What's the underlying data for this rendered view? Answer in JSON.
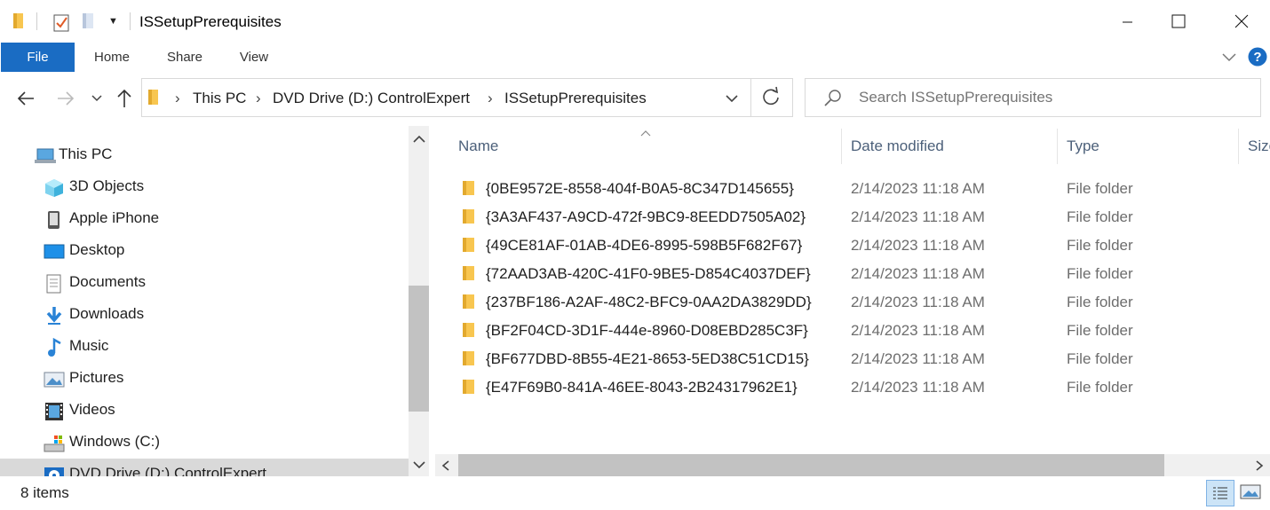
{
  "window": {
    "title": "ISSetupPrerequisites"
  },
  "ribbon": {
    "tabs": [
      "File",
      "Home",
      "Share",
      "View"
    ]
  },
  "address": {
    "crumbs": [
      "This PC",
      "DVD Drive (D:) ControlExpert",
      "ISSetupPrerequisites"
    ],
    "search_placeholder": "Search ISSetupPrerequisites"
  },
  "nav": {
    "items": [
      {
        "label": "This PC",
        "icon": "this-pc-icon"
      },
      {
        "label": "3D Objects",
        "icon": "3d-objects-icon"
      },
      {
        "label": "Apple iPhone",
        "icon": "phone-icon"
      },
      {
        "label": "Desktop",
        "icon": "desktop-icon"
      },
      {
        "label": "Documents",
        "icon": "documents-icon"
      },
      {
        "label": "Downloads",
        "icon": "downloads-icon"
      },
      {
        "label": "Music",
        "icon": "music-icon"
      },
      {
        "label": "Pictures",
        "icon": "pictures-icon"
      },
      {
        "label": "Videos",
        "icon": "videos-icon"
      },
      {
        "label": "Windows (C:)",
        "icon": "drive-icon"
      },
      {
        "label": "DVD Drive (D:) ControlExpert",
        "icon": "dvd-drive-icon"
      }
    ]
  },
  "columns": {
    "name": "Name",
    "date": "Date modified",
    "type": "Type",
    "size": "Size"
  },
  "files": [
    {
      "name": "{0BE9572E-8558-404f-B0A5-8C347D145655}",
      "date": "2/14/2023 11:18 AM",
      "type": "File folder"
    },
    {
      "name": "{3A3AF437-A9CD-472f-9BC9-8EEDD7505A02}",
      "date": "2/14/2023 11:18 AM",
      "type": "File folder"
    },
    {
      "name": "{49CE81AF-01AB-4DE6-8995-598B5F682F67}",
      "date": "2/14/2023 11:18 AM",
      "type": "File folder"
    },
    {
      "name": "{72AAD3AB-420C-41F0-9BE5-D854C4037DEF}",
      "date": "2/14/2023 11:18 AM",
      "type": "File folder"
    },
    {
      "name": "{237BF186-A2AF-48C2-BFC9-0AA2DA3829DD}",
      "date": "2/14/2023 11:18 AM",
      "type": "File folder"
    },
    {
      "name": "{BF2F04CD-3D1F-444e-8960-D08EBD285C3F}",
      "date": "2/14/2023 11:18 AM",
      "type": "File folder"
    },
    {
      "name": "{BF677DBD-8B55-4E21-8653-5ED38C51CD15}",
      "date": "2/14/2023 11:18 AM",
      "type": "File folder"
    },
    {
      "name": "{E47F69B0-841A-46EE-8043-2B24317962E1}",
      "date": "2/14/2023 11:18 AM",
      "type": "File folder"
    }
  ],
  "status": {
    "items_text": "8 items"
  },
  "colors": {
    "accent": "#1a6cc3",
    "folder": "#f8c650",
    "help": "#1a6cc3"
  }
}
